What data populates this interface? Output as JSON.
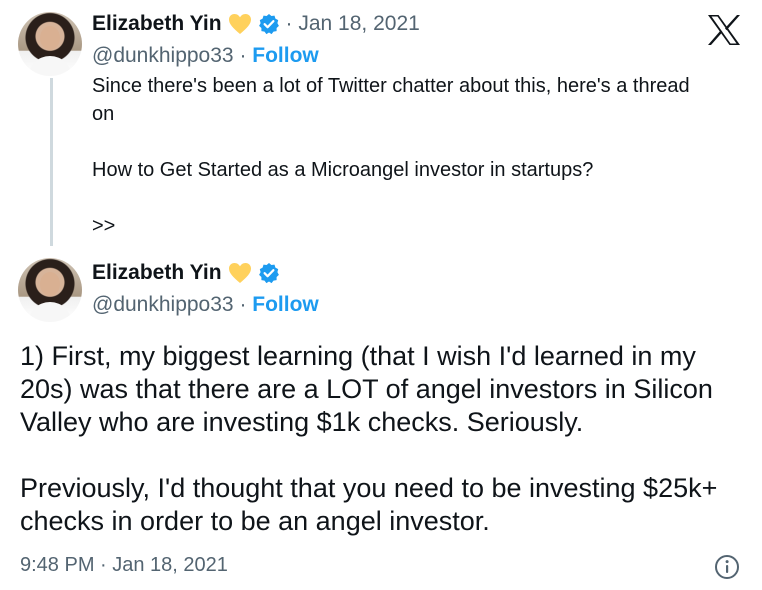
{
  "tweet1": {
    "author_name": "Elizabeth Yin",
    "date": "· Jan 18, 2021",
    "handle": "@dunkhippo33",
    "separator": " · ",
    "follow_label": "Follow",
    "lines": [
      "Since there's been a lot of Twitter chatter about this, here's a thread on",
      "",
      "How to Get Started as a Microangel investor in startups?",
      "",
      ">>"
    ]
  },
  "tweet2": {
    "author_name": "Elizabeth Yin",
    "handle": "@dunkhippo33",
    "separator": " · ",
    "follow_label": "Follow",
    "paragraph1": "1) First, my biggest learning (that I wish I'd learned in my 20s) was that there are a LOT of angel investors in Silicon Valley who are investing $1k checks. Seriously.",
    "paragraph2": "Previously, I'd thought that you need to be investing $25k+ checks in order to be an angel investor.",
    "timestamp": "9:48 PM · Jan 18, 2021"
  },
  "icons": {
    "badge": "heart-icon",
    "verified": "verified-badge-icon",
    "logo": "x-logo-icon",
    "info": "info-icon"
  },
  "colors": {
    "text": "#0f1419",
    "secondary": "#536471",
    "accent": "#1d9bf0",
    "heart": "#ffd15c",
    "thread_line": "#cfd9de"
  }
}
